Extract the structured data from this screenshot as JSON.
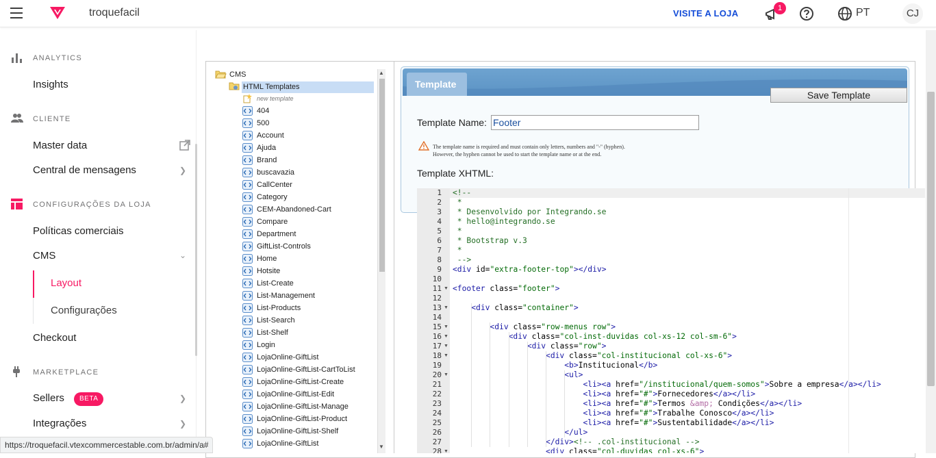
{
  "topbar": {
    "store_name": "troquefacil",
    "visit_store": "VISITE A LOJA",
    "notifications": "1",
    "language": "PT",
    "avatar_initials": "CJ",
    "accent": "#f71963",
    "link_color": "#134cd8"
  },
  "sidebar": {
    "analytics": "ANALYTICS",
    "insights": "Insights",
    "cliente": "CLIENTE",
    "master_data": "Master data",
    "central": "Central de mensagens",
    "config": "CONFIGURAÇÕES DA LOJA",
    "politicas": "Políticas comerciais",
    "cms": "CMS",
    "layout": "Layout",
    "configuracoes": "Configurações",
    "checkout": "Checkout",
    "marketplace": "MARKETPLACE",
    "sellers": "Sellers",
    "beta": "BETA",
    "integracoes": "Integrações"
  },
  "tree": {
    "root": "CMS",
    "folder": "HTML Templates",
    "new_template": "new template",
    "items": [
      "404",
      "500",
      "Account",
      "Ajuda",
      "Brand",
      "buscavazia",
      "CallCenter",
      "Category",
      "CEM-Abandoned-Cart",
      "Compare",
      "Department",
      "GiftList-Controls",
      "Home",
      "Hotsite",
      "List-Create",
      "List-Management",
      "List-Products",
      "List-Search",
      "List-Shelf",
      "Login",
      "LojaOnline-GiftList",
      "LojaOnline-GiftList-CartToList",
      "LojaOnline-GiftList-Create",
      "LojaOnline-GiftList-Edit",
      "LojaOnline-GiftList-Manage",
      "LojaOnline-GiftList-Product",
      "LojaOnline-GiftList-Shelf",
      "LojaOnline-GiftList"
    ]
  },
  "template": {
    "tab": "Template",
    "save_button": "Save Template",
    "name_label": "Template Name:",
    "name_value": "Footer",
    "warning_line1": "The template name is required and must contain only letters, numbers and \"-\" (hyphen).",
    "warning_line2": "However, the hyphen cannot be used to start the template name or at the end.",
    "xhtml_label": "Template XHTML:"
  },
  "code_lines": [
    "<!--",
    " *",
    " * Desenvolvido por Integrando.se",
    " * hello@integrando.se",
    " *",
    " * Bootstrap v.3",
    " *",
    " -->",
    "<div id=\"extra-footer-top\"></div>",
    "",
    "<footer class=\"footer\">",
    "",
    "    <div class=\"container\">",
    "",
    "        <div class=\"row-menus row\">",
    "            <div class=\"col-inst-duvidas col-xs-12 col-sm-6\">",
    "                <div class=\"row\">",
    "                    <div class=\"col-institucional col-xs-6\">",
    "                        <b>Institucional</b>",
    "                        <ul>",
    "                            <li><a href=\"/institucional/quem-somos\">Sobre a empresa</a></li>",
    "                            <li><a href=\"#\">Fornecedores</a></li>",
    "                            <li><a href=\"#\">Termos &amp; Condições</a></li>",
    "                            <li><a href=\"#\">Trabalhe Conosco</a></li>",
    "                            <li><a href=\"#\">Sustentabilidade</a></li>",
    "                        </ul>",
    "                    </div><!-- .col-institucional -->",
    "                    <div class=\"col-duvidas col-xs-6\">"
  ],
  "folds": [
    11,
    13,
    15,
    16,
    17,
    18,
    20,
    28
  ],
  "status_url": "https://troquefacil.vtexcommercestable.com.br/admin/a#"
}
